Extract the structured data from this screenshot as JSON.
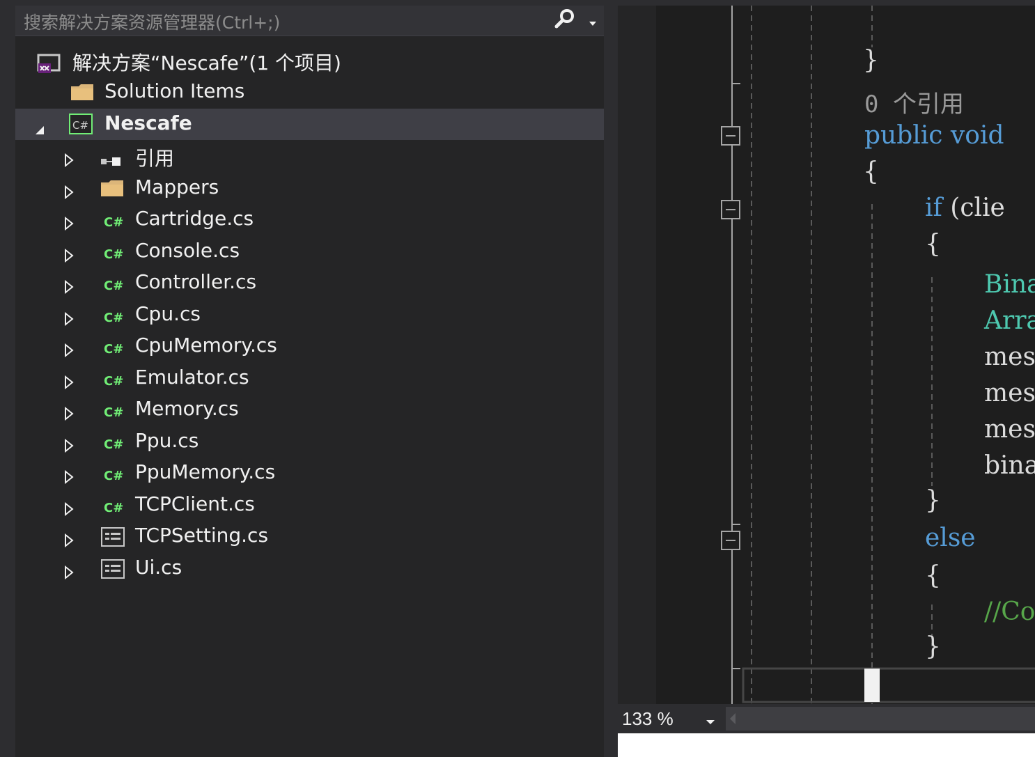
{
  "explorer": {
    "search_placeholder": "搜索解决方案资源管理器(Ctrl+;)",
    "solution_label": "解决方案“Nescafe”(1 个项目)",
    "solution_items_label": "Solution Items",
    "project_label": "Nescafe",
    "items": [
      {
        "label": "引用",
        "icon": "references-icon"
      },
      {
        "label": "Mappers",
        "icon": "folder-icon"
      },
      {
        "label": "Cartridge.cs",
        "icon": "csharp-file-icon"
      },
      {
        "label": "Console.cs",
        "icon": "csharp-file-icon"
      },
      {
        "label": "Controller.cs",
        "icon": "csharp-file-icon"
      },
      {
        "label": "Cpu.cs",
        "icon": "csharp-file-icon"
      },
      {
        "label": "CpuMemory.cs",
        "icon": "csharp-file-icon"
      },
      {
        "label": "Emulator.cs",
        "icon": "csharp-file-icon"
      },
      {
        "label": "Memory.cs",
        "icon": "csharp-file-icon"
      },
      {
        "label": "Ppu.cs",
        "icon": "csharp-file-icon"
      },
      {
        "label": "PpuMemory.cs",
        "icon": "csharp-file-icon"
      },
      {
        "label": "TCPClient.cs",
        "icon": "csharp-file-icon"
      },
      {
        "label": "TCPSetting.cs",
        "icon": "form-file-icon"
      },
      {
        "label": "Ui.cs",
        "icon": "form-file-icon"
      }
    ]
  },
  "editor": {
    "lines": {
      "close_brace_1": "}",
      "ref_count": "0 个引用",
      "public_kw": "public",
      "void_kw": "void",
      "open_brace_1": "{",
      "if_kw": "if",
      "if_rest": "(clie",
      "open_brace_2": "{",
      "bina": "Bina",
      "arra": "Arra",
      "mess1": "mess",
      "mess2": "mess",
      "mess3": "mess",
      "bina2": "bina",
      "close_brace_2": "}",
      "else_kw": "else",
      "open_brace_3": "{",
      "comment": "//Co",
      "close_brace_3": "}"
    }
  },
  "status": {
    "zoom": "133 %"
  }
}
